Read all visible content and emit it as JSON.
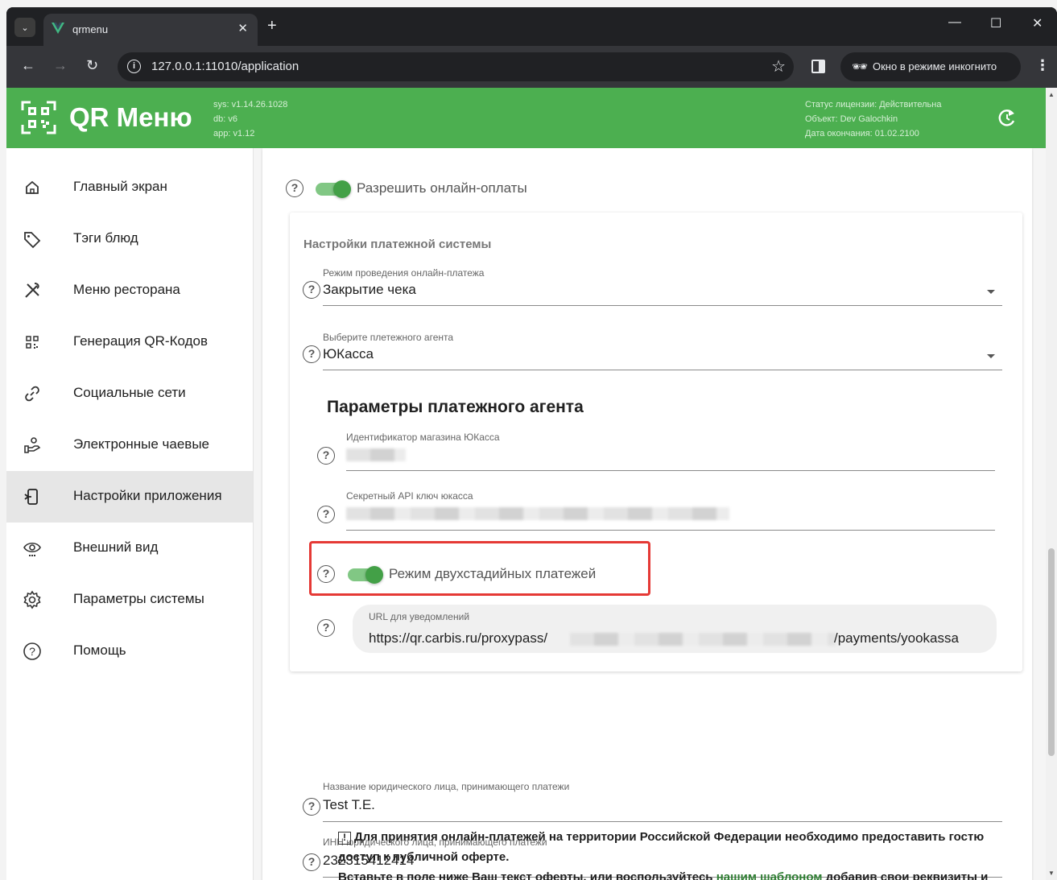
{
  "browser": {
    "tab_title": "qrmenu",
    "url": "127.0.0.1:11010/application",
    "incognito_label": "Окно в режиме инкогнито"
  },
  "header": {
    "brand": "QR Меню",
    "version": {
      "sys": "sys: v1.14.26.1028",
      "db": "db: v6",
      "app": "app: v1.12"
    },
    "license": {
      "status": "Статус лицензии: Действительна",
      "object": "Объект: Dev Galochkin",
      "expires": "Дата окончания: 01.02.2100"
    }
  },
  "sidebar": {
    "items": [
      {
        "label": "Главный экран",
        "icon": "home-icon"
      },
      {
        "label": "Тэги блюд",
        "icon": "tag-icon"
      },
      {
        "label": "Меню ресторана",
        "icon": "cutlery-icon"
      },
      {
        "label": "Генерация QR-Кодов",
        "icon": "qr-code-icon"
      },
      {
        "label": "Социальные сети",
        "icon": "link-icon"
      },
      {
        "label": "Электронные чаевые",
        "icon": "tips-icon"
      },
      {
        "label": "Настройки приложения",
        "icon": "app-settings-icon",
        "active": true
      },
      {
        "label": "Внешний вид",
        "icon": "eye-icon"
      },
      {
        "label": "Параметры системы",
        "icon": "gear-icon"
      },
      {
        "label": "Помощь",
        "icon": "help-icon"
      }
    ]
  },
  "main": {
    "allow_online_payments": {
      "label": "Разрешить онлайн-оплаты",
      "checked": true
    },
    "payment_system": {
      "title": "Настройки платежной системы",
      "mode": {
        "label": "Режим проведения онлайн-платежа",
        "value": "Закрытие чека"
      },
      "agent": {
        "label": "Выберите плетежного агента",
        "value": "ЮКасса"
      },
      "agent_params": {
        "title": "Параметры платежного агента",
        "shop_id_label": "Идентификатор магазина ЮКасса",
        "secret_key_label": "Секретный API ключ юкасса",
        "two_stage": {
          "label": "Режим двухстадийных платежей",
          "checked": true
        },
        "notify_url": {
          "label": "URL для уведомлений",
          "prefix": "https://qr.carbis.ru/proxypass/",
          "suffix": "/payments/yookassa"
        }
      }
    },
    "legal_name": {
      "label": "Название юридического лица, принимающего платежи",
      "value": "Test T.E."
    },
    "inn": {
      "label": "ИНН юридического лица, принимающего платежи",
      "value": "232315412414"
    },
    "notice": {
      "line1": "Для принятия онлайн-платежей на территории Российской Федерации необходимо предоставить гостю",
      "line2": "доступ к публичной оферте.",
      "line3_before": "Вставьте в поле ниже Ваш текст оферты, или воспользуйтесь ",
      "line3_link": "нашим шаблоном",
      "line3_after": " добавив свои реквизиты и"
    }
  },
  "colors": {
    "accent": "#4caf50",
    "switch_knob": "#43a047",
    "highlight": "#e53935"
  }
}
